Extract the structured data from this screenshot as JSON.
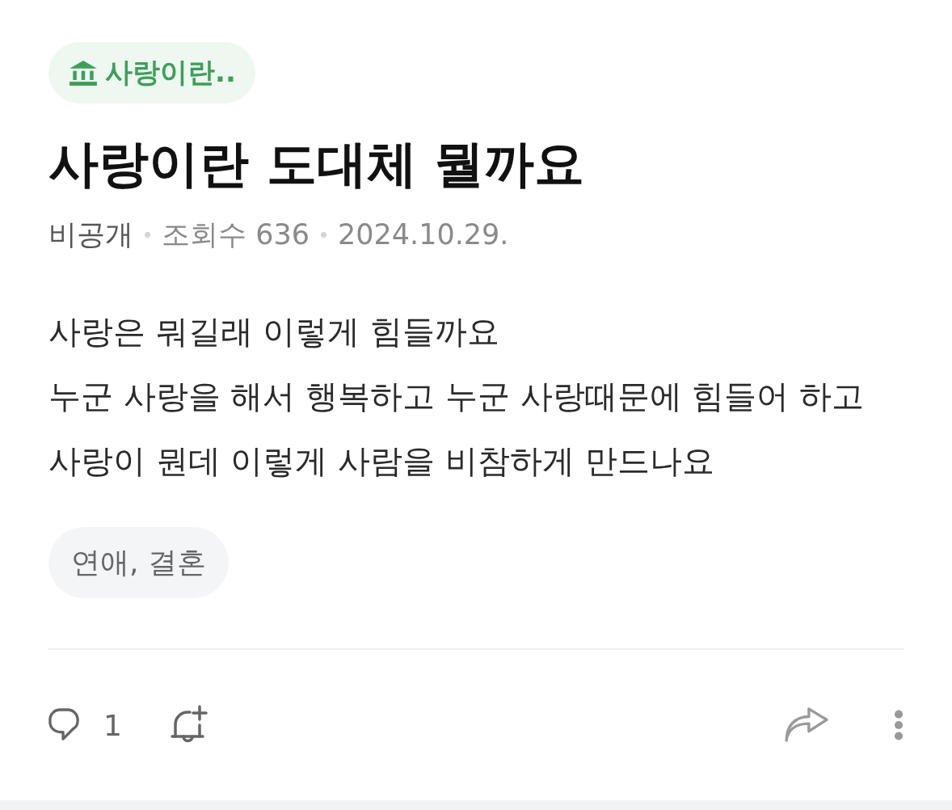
{
  "category": {
    "label": "사랑이란.."
  },
  "title": "사랑이란 도대체 뭘까요",
  "meta": {
    "visibility": "비공개",
    "views": "조회수 636",
    "date": "2024.10.29."
  },
  "body": [
    "사랑은 뭐길래 이렇게 힘들까요",
    "누군 사랑을 해서 행복하고 누군 사랑때문에 힘들어 하고",
    "사랑이 뭔데 이렇게 사람을 비참하게 만드나요"
  ],
  "tags": [
    "연애, 결혼"
  ],
  "actions": {
    "comment_count": "1"
  }
}
